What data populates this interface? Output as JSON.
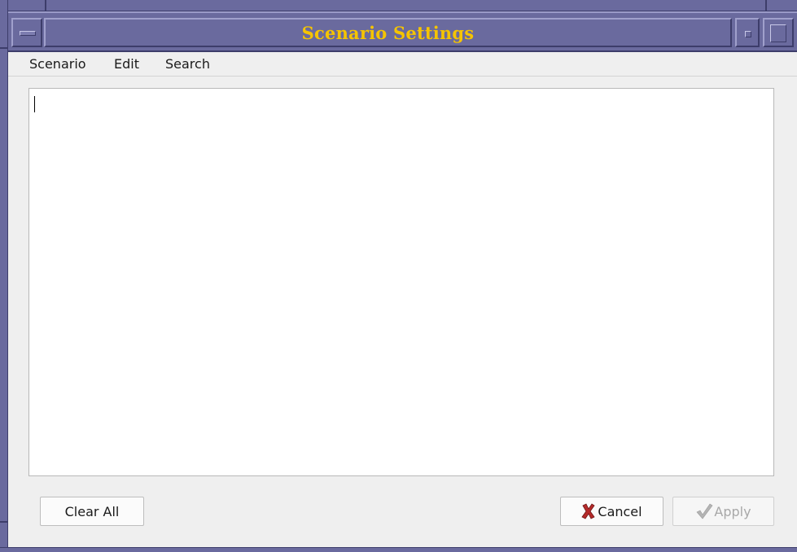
{
  "window": {
    "title": "Scenario Settings",
    "title_color": "#f5c400",
    "frame_color": "#6a6a9e"
  },
  "titlebar_icons": {
    "menu": "window-menu-icon",
    "minimize": "minimize-icon",
    "maximize": "maximize-icon"
  },
  "menubar": {
    "items": [
      {
        "label": "Scenario"
      },
      {
        "label": "Edit"
      },
      {
        "label": "Search"
      }
    ]
  },
  "editor": {
    "value": ""
  },
  "buttons": {
    "clear_all": "Clear All",
    "cancel": "Cancel",
    "cancel_icon": "red-x-icon",
    "apply": "Apply",
    "apply_icon": "checkmark-icon",
    "apply_disabled": true
  },
  "colors": {
    "cancel_icon": "#b52a2a",
    "disabled_text": "#a8a8a8"
  }
}
